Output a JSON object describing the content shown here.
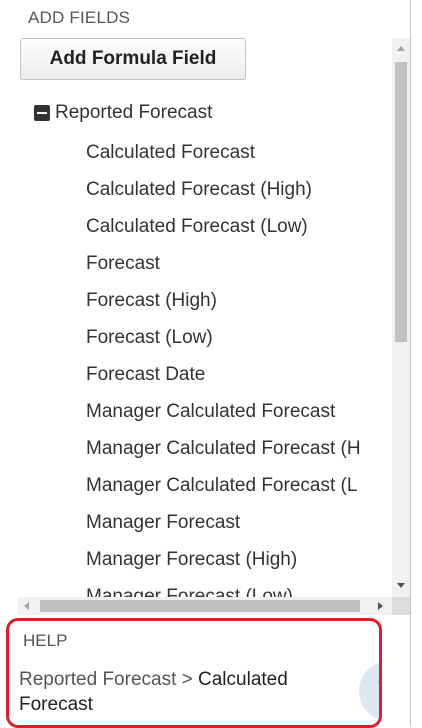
{
  "header": {
    "title": "ADD FIELDS"
  },
  "toolbar": {
    "add_formula_label": "Add Formula Field"
  },
  "tree": {
    "root_label": "Reported Forecast",
    "root_expanded": true,
    "items": [
      "Calculated Forecast",
      "Calculated Forecast (High)",
      "Calculated Forecast (Low)",
      "Forecast",
      "Forecast (High)",
      "Forecast (Low)",
      "Forecast Date",
      "Manager Calculated Forecast",
      "Manager Calculated Forecast (H",
      "Manager Calculated Forecast (L",
      "Manager Forecast",
      "Manager Forecast (High)",
      "Manager Forecast (Low)"
    ]
  },
  "help": {
    "title": "HELP",
    "path": "Reported Forecast",
    "separator": " > ",
    "current": "Calculated Forecast",
    "icon": "question-icon",
    "icon_glyph": "?"
  },
  "colors": {
    "highlight_border": "#e01e2b",
    "text": "#333333",
    "scroll_thumb": "#c1c1c1"
  }
}
